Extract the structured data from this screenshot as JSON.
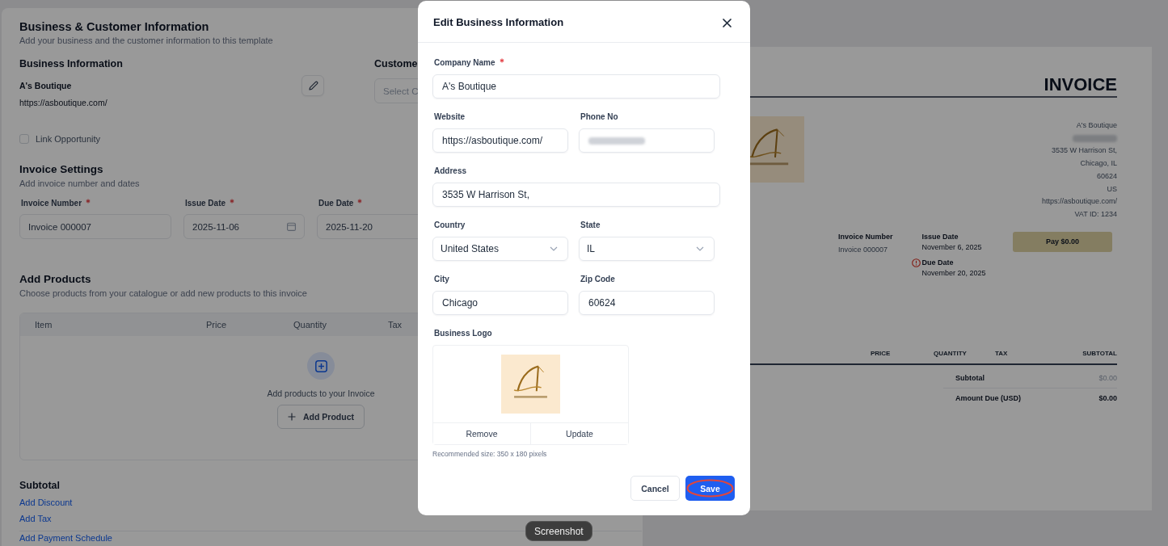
{
  "business_customer": {
    "title": "Business & Customer Information",
    "subtitle": "Add your business and the customer information to this template",
    "business": {
      "heading": "Business Information",
      "name": "A's Boutique",
      "website": "https://asboutique.com/"
    },
    "customer": {
      "heading": "Custome",
      "placeholder": "Select C"
    },
    "link_opportunity": {
      "label": "Link Opportunity",
      "checked": false
    }
  },
  "invoice_settings": {
    "title": "Invoice Settings",
    "subtitle": "Add invoice number and dates",
    "fields": [
      {
        "kind": "text",
        "label": "Invoice Number",
        "required": true,
        "value": "Invoice 000007"
      },
      {
        "kind": "date",
        "label": "Issue Date",
        "required": true,
        "value": "2025-11-06"
      },
      {
        "kind": "text",
        "label": "Due Date",
        "required": true,
        "value": "2025-11-20"
      }
    ]
  },
  "products": {
    "title": "Add Products",
    "subtitle": "Choose products from your catalogue or add new products to this invoice",
    "columns": [
      "Item",
      "Price",
      "Quantity",
      "Tax"
    ],
    "empty_text": "Add products to your Invoice",
    "add_button": "Add Product"
  },
  "totals": {
    "title": "Subtotal",
    "links": [
      "Add Discount",
      "Add Tax",
      "Add Payment Schedule"
    ]
  },
  "preview": {
    "title": "INVOICE",
    "business_lines": [
      {
        "kind": "text",
        "text": "A's Boutique"
      },
      {
        "kind": "blurred"
      },
      {
        "kind": "text",
        "text": "3535 W Harrison St,"
      },
      {
        "kind": "text",
        "text": "Chicago, IL"
      },
      {
        "kind": "text",
        "text": "60624"
      },
      {
        "kind": "text",
        "text": "US"
      },
      {
        "kind": "text",
        "text": "https://asboutique.com/"
      },
      {
        "kind": "text",
        "text": "VAT ID: 1234"
      }
    ],
    "invoice_number": {
      "label": "Invoice Number",
      "value": "Invoice 000007"
    },
    "dates": [
      {
        "label": "Issue Date",
        "value": "November 6, 2025",
        "overdue": false
      },
      {
        "label": "Due Date",
        "value": "November 20, 2025",
        "overdue": true
      }
    ],
    "pay_button": "Pay $0.00",
    "columns": [
      "PRICE",
      "QUANTITY",
      "TAX",
      "SUBTOTAL"
    ],
    "totals": [
      {
        "label": "Subtotal",
        "value": "$0.00",
        "emphasis": false
      },
      {
        "label": "Amount Due (USD)",
        "value": "$0.00",
        "emphasis": true
      }
    ]
  },
  "modal": {
    "title": "Edit Business Information",
    "rows": [
      [
        {
          "kind": "text",
          "label": "Company Name",
          "required": true,
          "value": "A's Boutique"
        }
      ],
      [
        {
          "kind": "text",
          "label": "Website",
          "required": false,
          "value": "https://asboutique.com/"
        },
        {
          "kind": "blurred",
          "label": "Phone No",
          "required": false
        }
      ],
      [
        {
          "kind": "text",
          "label": "Address",
          "required": false,
          "value": "3535 W Harrison St,"
        }
      ],
      [
        {
          "kind": "select",
          "label": "Country",
          "required": false,
          "value": "United States"
        },
        {
          "kind": "select",
          "label": "State",
          "required": false,
          "value": "IL"
        }
      ],
      [
        {
          "kind": "text",
          "label": "City",
          "required": false,
          "value": "Chicago"
        },
        {
          "kind": "text",
          "label": "Zip Code",
          "required": false,
          "value": "60624"
        }
      ]
    ],
    "logo": {
      "label": "Business Logo",
      "actions": [
        "Remove",
        "Update"
      ],
      "hint": "Recommended size: 350 x 180 pixels"
    },
    "buttons": [
      {
        "kind": "secondary",
        "label": "Cancel",
        "highlighted": false
      },
      {
        "kind": "primary",
        "label": "Save",
        "highlighted": true
      }
    ]
  },
  "tooltip": {
    "text": "Screenshot"
  }
}
